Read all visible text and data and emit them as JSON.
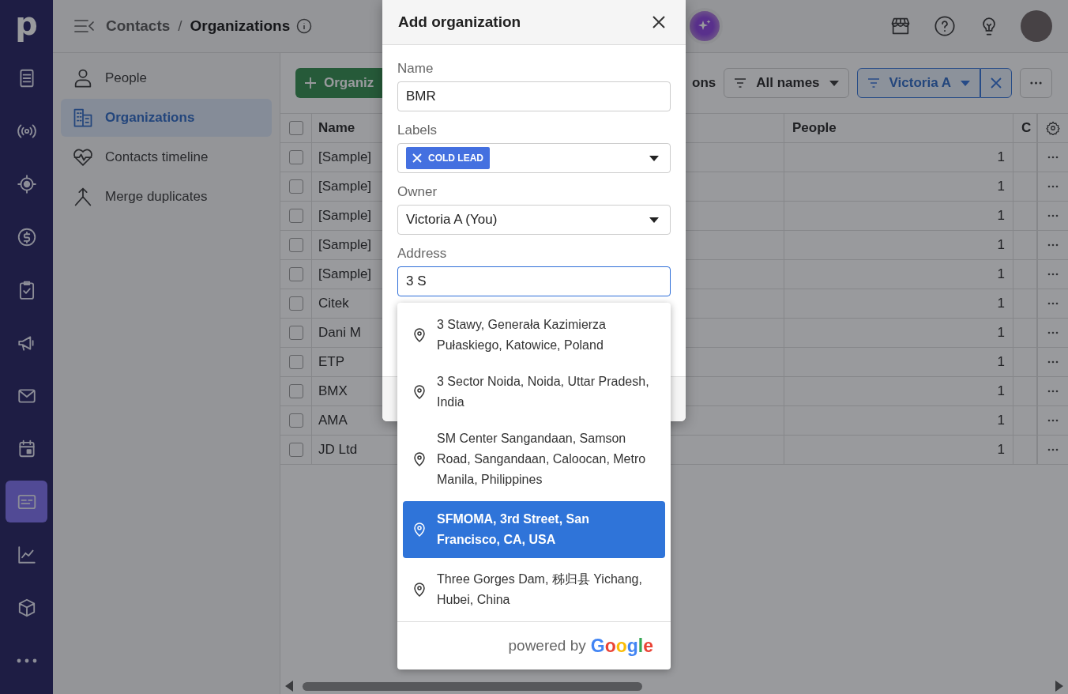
{
  "nav": {
    "logo": "p",
    "items": [
      {
        "selected": false
      },
      {
        "selected": false
      },
      {
        "selected": false
      },
      {
        "selected": false
      },
      {
        "selected": false
      },
      {
        "selected": false
      },
      {
        "selected": false
      },
      {
        "selected": false
      },
      {
        "selected": true
      },
      {
        "selected": false
      },
      {
        "selected": false
      },
      {
        "selected": false
      }
    ]
  },
  "breadcrumb": {
    "parent": "Contacts",
    "separator": "/",
    "current": "Organizations"
  },
  "subnav": [
    {
      "label": "People",
      "selected": false
    },
    {
      "label": "Organizations",
      "selected": true
    },
    {
      "label": "Contacts timeline",
      "selected": false
    },
    {
      "label": "Merge duplicates",
      "selected": false
    }
  ],
  "toolbar": {
    "add_button": "Organiz",
    "partial_text": "ons",
    "name_filter": "All names",
    "owner_filter": "Victoria A"
  },
  "table": {
    "columns": [
      "Name",
      "People",
      "C"
    ],
    "all_checked": false,
    "rows": [
      {
        "name": "[Sample]",
        "people": "1",
        "checked": false
      },
      {
        "name": "[Sample]",
        "people": "1",
        "checked": false
      },
      {
        "name": "[Sample]",
        "people": "1",
        "checked": false
      },
      {
        "name": "[Sample]",
        "people": "1",
        "checked": false
      },
      {
        "name": "[Sample]",
        "people": "1",
        "checked": false
      },
      {
        "name": "Citek",
        "people": "1",
        "checked": false
      },
      {
        "name": "Dani M",
        "people": "1",
        "checked": false
      },
      {
        "name": "ETP",
        "people": "1",
        "checked": false
      },
      {
        "name": "BMX",
        "people": "1",
        "checked": false
      },
      {
        "name": "AMA",
        "people": "1",
        "checked": false
      },
      {
        "name": "JD Ltd",
        "people": "1",
        "checked": false
      }
    ]
  },
  "modal": {
    "title": "Add organization",
    "fields": [
      {
        "kind": "text",
        "label": "Name",
        "value": "BMR"
      },
      {
        "kind": "tags",
        "label": "Labels",
        "tags": [
          "COLD LEAD"
        ]
      },
      {
        "kind": "select",
        "label": "Owner",
        "value": "Victoria A (You)"
      },
      {
        "kind": "address",
        "label": "Address",
        "value": "3 S"
      }
    ]
  },
  "suggestions": [
    {
      "text": "3 Stawy, Generała Kazimierza Pułaskiego, Katowice, Poland",
      "selected": false
    },
    {
      "text": "3 Sector Noida, Noida, Uttar Pradesh, India",
      "selected": false
    },
    {
      "text": "SM Center Sangandaan, Samson Road, Sangandaan, Caloocan, Metro Manila, Philippines",
      "selected": false
    },
    {
      "text": "SFMOMA, 3rd Street, San Francisco, CA, USA",
      "selected": true
    },
    {
      "text": "Three Gorges Dam, 秭归县 Yichang, Hubei, China",
      "selected": false
    }
  ],
  "attribution": {
    "text": "powered by",
    "brand": "Google"
  }
}
